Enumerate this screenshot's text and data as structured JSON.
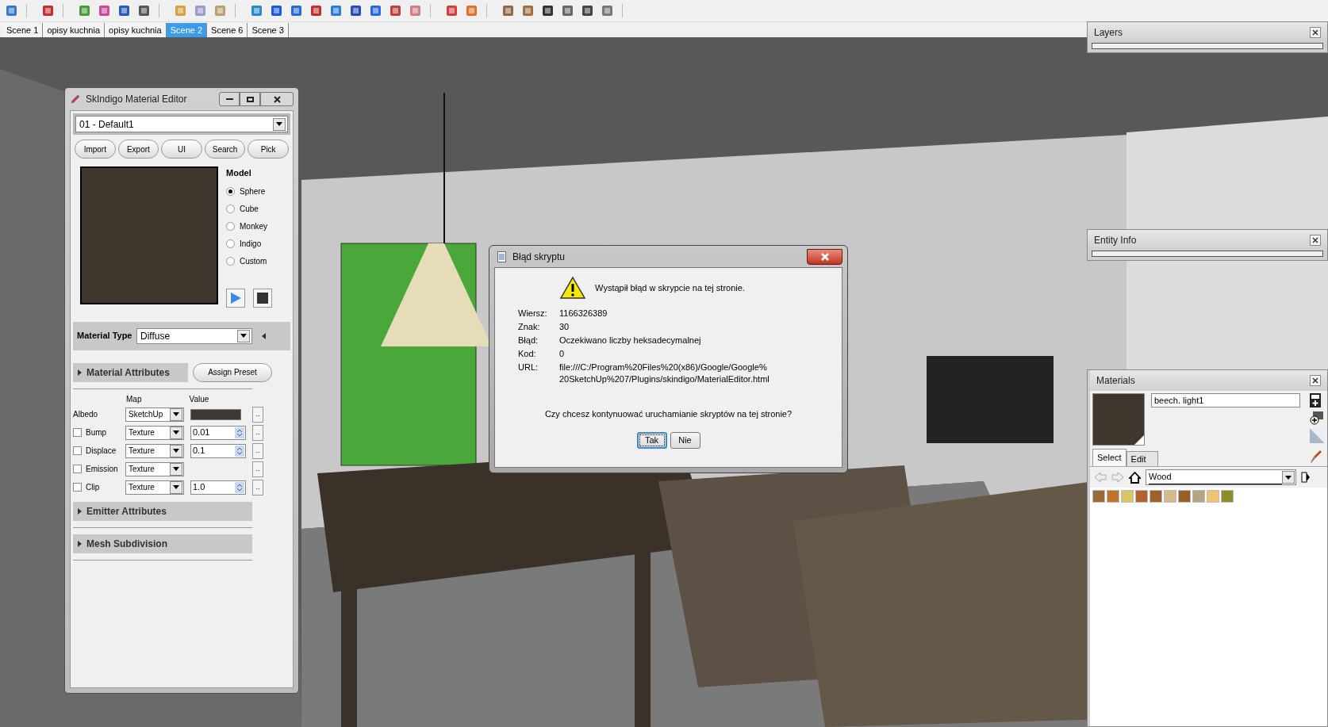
{
  "scene_tabs": [
    {
      "label": "Scene 1",
      "selected": false
    },
    {
      "label": "opisy kuchnia",
      "selected": false
    },
    {
      "label": "opisy kuchnia",
      "selected": false
    },
    {
      "label": "Scene 2",
      "selected": true
    },
    {
      "label": "Scene 6",
      "selected": false
    },
    {
      "label": "Scene 3",
      "selected": false
    }
  ],
  "material_editor": {
    "title": "SkIndigo Material Editor",
    "material": "01 - Default1",
    "buttons": [
      "Import",
      "Export",
      "UI",
      "Search",
      "Pick"
    ],
    "model_label": "Model",
    "models": [
      {
        "label": "Sphere",
        "selected": true
      },
      {
        "label": "Cube",
        "selected": false
      },
      {
        "label": "Monkey",
        "selected": false
      },
      {
        "label": "Indigo",
        "selected": false
      },
      {
        "label": "Custom",
        "selected": false
      }
    ],
    "material_type_label": "Material Type",
    "material_type": "Diffuse",
    "attributes_section": "Material Attributes",
    "assign_preset": "Assign Preset",
    "map_header": "Map",
    "value_header": "Value",
    "attributes": [
      {
        "kind": "color",
        "label": "Albedo",
        "map": "SketchUp",
        "browse": ".."
      },
      {
        "kind": "spin",
        "label": "Bump",
        "checked": false,
        "map": "Texture",
        "value": "0.01",
        "browse": ".."
      },
      {
        "kind": "spin",
        "label": "Displace",
        "checked": false,
        "map": "Texture",
        "value": "0.1",
        "browse": ".."
      },
      {
        "kind": "plain",
        "label": "Emission",
        "checked": false,
        "map": "Texture",
        "browse": ".."
      },
      {
        "kind": "spin",
        "label": "Clip",
        "checked": false,
        "map": "Texture",
        "value": "1.0",
        "browse": ".."
      }
    ],
    "sections": [
      "Emitter Attributes",
      "Mesh Subdivision"
    ]
  },
  "dialog": {
    "title": "Błąd skryptu",
    "message": "Wystąpił błąd w skrypcie na tej stronie.",
    "fields": [
      {
        "label": "Wiersz:",
        "value": "1166326389"
      },
      {
        "label": "Znak:",
        "value": "30"
      },
      {
        "label": "Błąd:",
        "value": "Oczekiwano liczby heksadecymalnej"
      },
      {
        "label": "Kod:",
        "value": "0"
      },
      {
        "label": "URL:",
        "lines": [
          "file:///C:/Program%20Files%20(x86)/Google/Google%",
          "20SketchUp%207/Plugins/skindigo/MaterialEditor.html"
        ]
      }
    ],
    "question": "Czy chcesz kontynuować uruchamianie skryptów na tej stronie?",
    "buttons": [
      {
        "label": "Tak",
        "focused": true
      },
      {
        "label": "Nie",
        "focused": false
      }
    ]
  },
  "layers": {
    "title": "Layers"
  },
  "entity_info": {
    "title": "Entity Info"
  },
  "materials": {
    "title": "Materials",
    "name": "beech. light1",
    "tabs": [
      {
        "label": "Select",
        "selected": true
      },
      {
        "label": "Edit",
        "selected": false
      }
    ],
    "collection": "Wood",
    "swatches": [
      {
        "color": "#9a6a3a"
      },
      {
        "color": "#c0732a"
      },
      {
        "color": "#d9c466"
      },
      {
        "color": "#b5632c"
      },
      {
        "color": "#a0602e"
      },
      {
        "color": "#d4b98a"
      },
      {
        "color": "#9a5e25"
      },
      {
        "color": "#b3a580"
      },
      {
        "color": "#f0c474"
      },
      {
        "color": "#8f8c2a"
      }
    ]
  }
}
